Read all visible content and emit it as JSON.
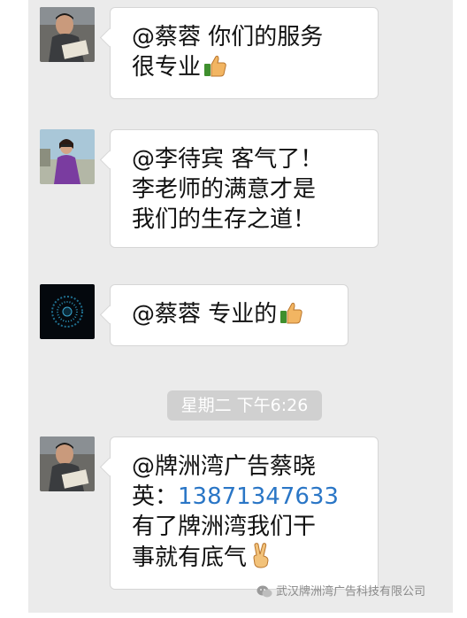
{
  "messages": [
    {
      "avatar": "avatar-man-reading",
      "lines": [
        "@蔡蓉 你们的服务",
        "很专业"
      ],
      "emoji": "thumbs-up-icon"
    },
    {
      "avatar": "avatar-woman-outdoors",
      "lines": [
        "@李待宾 客气了！",
        "李老师的满意才是",
        "我们的生存之道！"
      ]
    },
    {
      "avatar": "avatar-dark-abstract",
      "lines": [
        "@蔡蓉 专业的"
      ],
      "emoji": "thumbs-up-icon"
    },
    {
      "avatar": "avatar-man-reading",
      "lines": [
        "@牌洲湾广告蔡晓",
        "英：",
        "有了牌洲湾我们干",
        "事就有底气"
      ],
      "phone": "13871347633",
      "emoji": "victory-hand-icon"
    }
  ],
  "timestamp": "星期二 下午6:26",
  "watermark": "武汉牌洲湾广告科技有限公司",
  "colors": {
    "chat_background": "#ebebeb",
    "bubble": "#ffffff",
    "timestamp_pill": "#d0d0d0",
    "phone_link": "#2a76c6"
  }
}
